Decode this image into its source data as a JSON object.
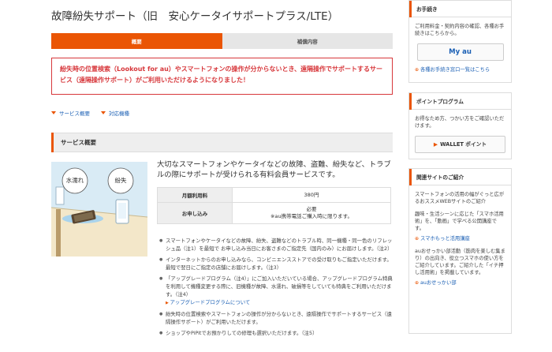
{
  "page": {
    "title": "故障紛失サポート（旧　安心ケータイサポートプラス/LTE）"
  },
  "tabs": [
    {
      "label": "概要",
      "active": true
    },
    {
      "label": "補償内容",
      "active": false
    }
  ],
  "notice": {
    "text": "紛失時の位置検索（Lookout for au）やスマートフォンの操作が分からないとき、遠隔操作でサポートするサービス（遠隔操作サポート）がご利用いただけるようになりました！"
  },
  "anchors": [
    {
      "label": "サービス概要"
    },
    {
      "label": "対応機種"
    }
  ],
  "section": {
    "title": "サービス概要"
  },
  "illustration": {
    "bubble_left": "水濡れ",
    "bubble_right": "紛失"
  },
  "lead": "大切なスマートフォンやケータイなどの故障、盗難、紛失など、トラブルの際にサポートが受けられる有料会員サービスです。",
  "table": {
    "rows": [
      {
        "label": "月額利用料",
        "value": "380円",
        "note": ""
      },
      {
        "label": "お申し込み",
        "value": "必要",
        "note": "※au携帯電話ご購入時に限ります。"
      }
    ]
  },
  "bullets": [
    {
      "text": "スマートフォンやケータイなどの故障、紛失、盗難などのトラブル時、同一機種・同一色のリフレッシュ品（注1）を最短で お申し込み当日にお客さまのご指定先（国内のみ）にお届けします。（注2）",
      "link": ""
    },
    {
      "text": "インターネットからのお申し込みなら、コンビニエンスストアでの受け取りもご指定いただけます。最短で翌日にご指定の店舗にお届けします。（注3）",
      "link": ""
    },
    {
      "text": "「アップグレードプログラム（注4）」にご加入いただいている場合、アップグレードプログラム特典を利用して機種変更する際に、旧機種が故障、水濡れ、破損等をしていても特典をご利用いただけます。（注4）",
      "link": "アップグレードプログラムについて"
    },
    {
      "text": "紛失時の位置検索やスマートフォンの操作が分からないとき、遠隔操作でサポートするサービス（遠隔操作サポート）がご利用いただけます。",
      "link": ""
    },
    {
      "text": "ショップやPiPitでお預かりしての修理も選択いただけます。（注5）",
      "link": ""
    }
  ],
  "sidebar": {
    "procedures": {
      "title": "お手続き",
      "text": "ご利用料金・契約内容の確認、各種お手続きはこちらから。",
      "button": "My au",
      "link": "各種お手続き窓口一覧はこちら"
    },
    "points": {
      "title": "ポイントプログラム",
      "text": "お得なため方、つかい方をご確認いただけます。",
      "button": "WALLET ポイント"
    },
    "related": {
      "title": "関連サイトのご紹介",
      "text1": "スマートフォンの活用の幅がぐっと広がるおススメWEBサイトのご紹介",
      "text2": "趣味・生活シーンに応じた「スマホ活用術」を、「動画」で学べる公開講座です。",
      "link1": "スマホもっと活用講座",
      "text3": "auおせっかい部活動（筋肉を楽しむ集まり）の出向き、役立つスマホの使い方をご紹介しています。ご紹介した「イチ押し活用術」を掲載しています。",
      "link2": "auおせっかい部"
    }
  },
  "colors": {
    "accent": "#ea5504",
    "notice": "#d7373b",
    "link": "#1a5fb4"
  }
}
